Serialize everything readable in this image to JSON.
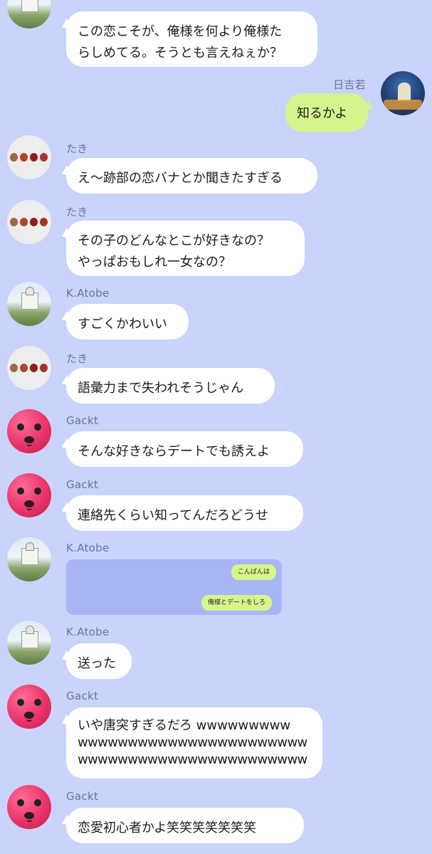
{
  "messages": [
    {
      "sender": "",
      "text": "この恋こそが、俺様を何より俺様たらしめてる。そうとも言えねぇか？",
      "lines": [
        "この恋こそが、俺様を何より俺様た",
        "らしめてる。そうとも言えねぇか？"
      ]
    },
    {
      "sender": "日吉若",
      "text": "知るかよ"
    },
    {
      "sender": "たき",
      "text": "え〜跡部の恋バナとか聞きたすぎる"
    },
    {
      "sender": "たき",
      "lines": [
        "その子のどんなとこが好きなの？",
        "やっぱおもしれ一女なの？"
      ]
    },
    {
      "sender": "K.Atobe",
      "text": "すごくかわいい"
    },
    {
      "sender": "たき",
      "text": "語彙力まで失われそうじゃん"
    },
    {
      "sender": "Gackt",
      "text": "そんな好きならデートでも誘えよ"
    },
    {
      "sender": "Gackt",
      "text": "連絡先くらい知ってんだろどうせ"
    },
    {
      "sender": "K.Atobe",
      "screenshot": {
        "line1": "こんばんは",
        "line2": "俺様とデートをしろ"
      }
    },
    {
      "sender": "K.Atobe",
      "text": "送った"
    },
    {
      "sender": "Gackt",
      "lines": [
        "いや唐突すぎるだろ wwwwwwwww",
        "wwwwwwwwwwwwwwwwwwwwwww",
        "wwwwwwwwwwwwwwwwwwwwwww"
      ]
    },
    {
      "sender": "Gackt",
      "text": "恋愛初心者かよ笑笑笑笑笑笑笑"
    }
  ],
  "colors": {
    "background": "#c9d3fb",
    "bubble_in": "#ffffff",
    "bubble_out": "#d6f58c",
    "sender_name": "#6b7398"
  }
}
